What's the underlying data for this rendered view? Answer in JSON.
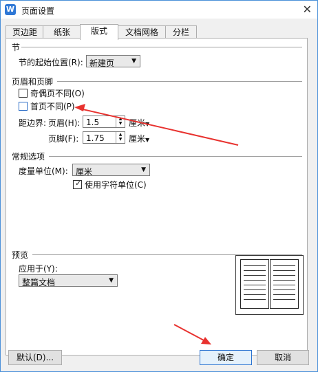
{
  "window": {
    "title": "页面设置",
    "app_icon": "W"
  },
  "tabs": [
    {
      "label": "页边距"
    },
    {
      "label": "纸张"
    },
    {
      "label": "版式"
    },
    {
      "label": "文档网格"
    },
    {
      "label": "分栏"
    }
  ],
  "section": {
    "title": "节",
    "start_label": "节的起始位置(R):",
    "start_value": "新建页"
  },
  "header_footer": {
    "title": "页眉和页脚",
    "odd_even_label": "奇偶页不同(O)",
    "odd_even_checked": false,
    "first_page_label": "首页不同(P)",
    "first_page_checked": false,
    "margin_label": "距边界:",
    "header_label": "页眉(H):",
    "header_value": "1.5",
    "header_unit": "厘米",
    "footer_label": "页脚(F):",
    "footer_value": "1.75",
    "footer_unit": "厘米"
  },
  "general": {
    "title": "常规选项",
    "unit_label": "度量单位(M):",
    "unit_value": "厘米",
    "char_unit_label": "使用字符单位(C)",
    "char_unit_checked": true
  },
  "preview": {
    "title": "预览",
    "apply_label": "应用于(Y):",
    "apply_value": "整篇文档"
  },
  "buttons": {
    "default_label": "默认(D)...",
    "ok_label": "确定",
    "cancel_label": "取消"
  },
  "colors": {
    "accent": "#2a72d0",
    "annotation_arrow": "#e8322f"
  }
}
